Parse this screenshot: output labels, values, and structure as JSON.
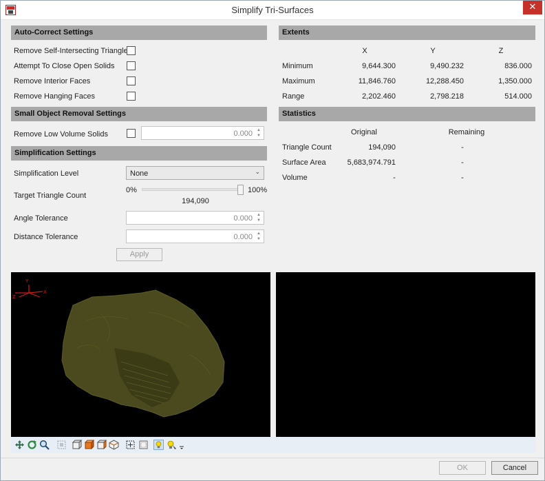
{
  "window": {
    "title": "Simplify Tri-Surfaces",
    "close_glyph": "✕"
  },
  "autocorrect": {
    "header": "Auto-Correct Settings",
    "items": [
      {
        "label": "Remove Self-Intersecting Triangles",
        "checked": false
      },
      {
        "label": "Attempt To Close Open Solids",
        "checked": false
      },
      {
        "label": "Remove Interior Faces",
        "checked": false
      },
      {
        "label": "Remove Hanging Faces",
        "checked": false
      }
    ]
  },
  "small_object": {
    "header": "Small Object Removal Settings",
    "label": "Remove Low Volume Solids",
    "checked": false,
    "value": "0.000"
  },
  "simplification": {
    "header": "Simplification Settings",
    "level_label": "Simplification Level",
    "level_value": "None",
    "target_label": "Target Triangle Count",
    "slider_min": "0%",
    "slider_max": "100%",
    "slider_value": 1.0,
    "target_count": "194,090",
    "angle_label": "Angle Tolerance",
    "angle_value": "0.000",
    "distance_label": "Distance Tolerance",
    "distance_value": "0.000",
    "apply_label": "Apply"
  },
  "extents": {
    "header": "Extents",
    "columns": [
      "X",
      "Y",
      "Z"
    ],
    "rows": [
      {
        "label": "Minimum",
        "values": [
          "9,644.300",
          "9,490.232",
          "836.000"
        ]
      },
      {
        "label": "Maximum",
        "values": [
          "11,846.760",
          "12,288.450",
          "1,350.000"
        ]
      },
      {
        "label": "Range",
        "values": [
          "2,202.460",
          "2,798.218",
          "514.000"
        ]
      }
    ]
  },
  "statistics": {
    "header": "Statistics",
    "columns": [
      "Original",
      "Remaining"
    ],
    "rows": [
      {
        "label": "Triangle Count",
        "values": [
          "194,090",
          "-"
        ]
      },
      {
        "label": "Surface Area",
        "values": [
          "5,683,974.791",
          "-"
        ]
      },
      {
        "label": "Volume",
        "values": [
          "-",
          "-"
        ]
      }
    ]
  },
  "viewer": {
    "axis_labels": [
      "Y",
      "X",
      "Z"
    ],
    "surface_color": "#4a4a1e",
    "background_color": "#000000",
    "toolbar_icons": [
      "pan-icon",
      "rotate-icon",
      "zoom-icon",
      "zoom-extents-icon",
      "view-front-icon",
      "view-side-icon",
      "view-top-icon",
      "view-iso-icon",
      "zoom-box-icon",
      "zoom-fit-icon",
      "light-icon",
      "light-settings-icon",
      "more-icon"
    ]
  },
  "footer": {
    "ok_label": "OK",
    "cancel_label": "Cancel"
  }
}
